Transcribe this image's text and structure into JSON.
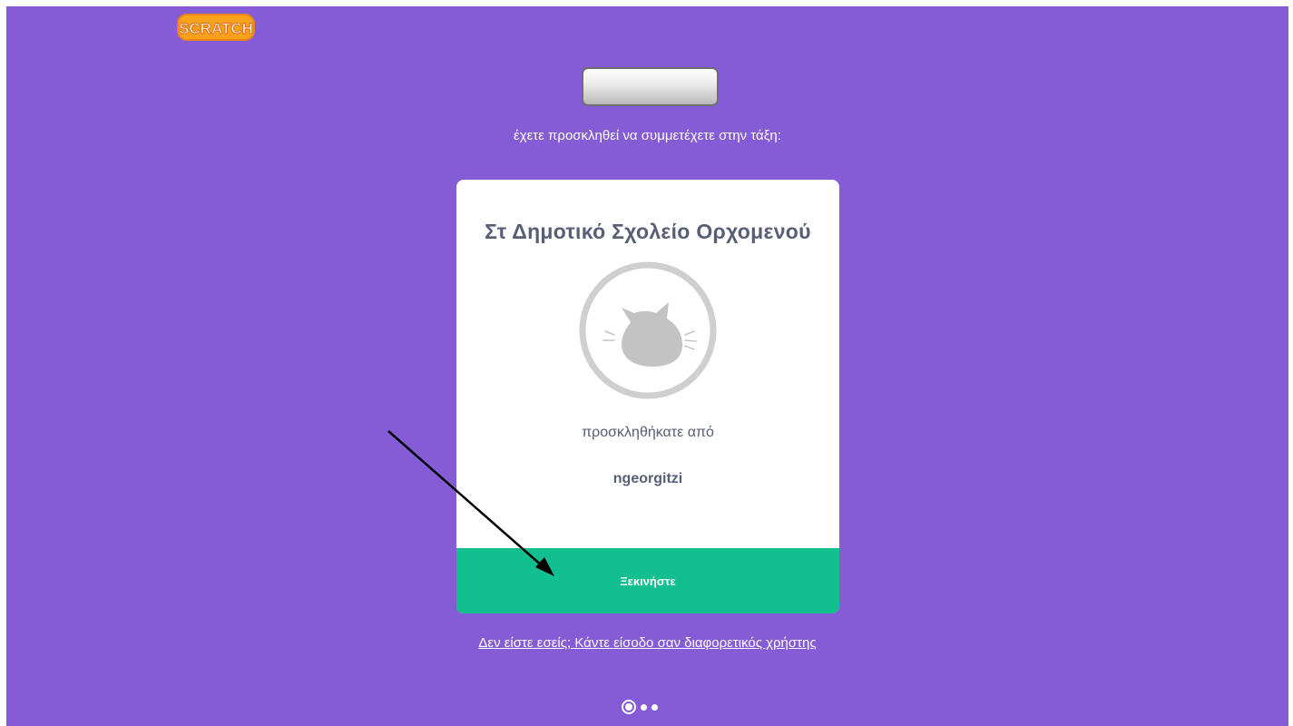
{
  "header": {
    "logo_text": "SCRATCH",
    "logo_icon": "scratch-logo"
  },
  "invite": {
    "invited_text": "έχετε προσκληθεί να συμμετέχετε στην τάξη:"
  },
  "class_card": {
    "class_title": "Στ Δημοτικό Σχολείο Ορχομενού",
    "thumbnail_icon": "cat-icon",
    "invited_by_label": "προσκληθήκατε από",
    "inviter_name": "ngeorgitzi",
    "start_button_label": "Ξεκινήστε"
  },
  "footer": {
    "switch_user_link": "Δεν είστε εσείς; Κάντε είσοδο σαν διαφορετικός χρήστης"
  },
  "steps": {
    "current": 1,
    "total": 3
  },
  "colors": {
    "background": "#855cd6",
    "start_button": "#12bf8e",
    "title_text": "#575e75"
  }
}
